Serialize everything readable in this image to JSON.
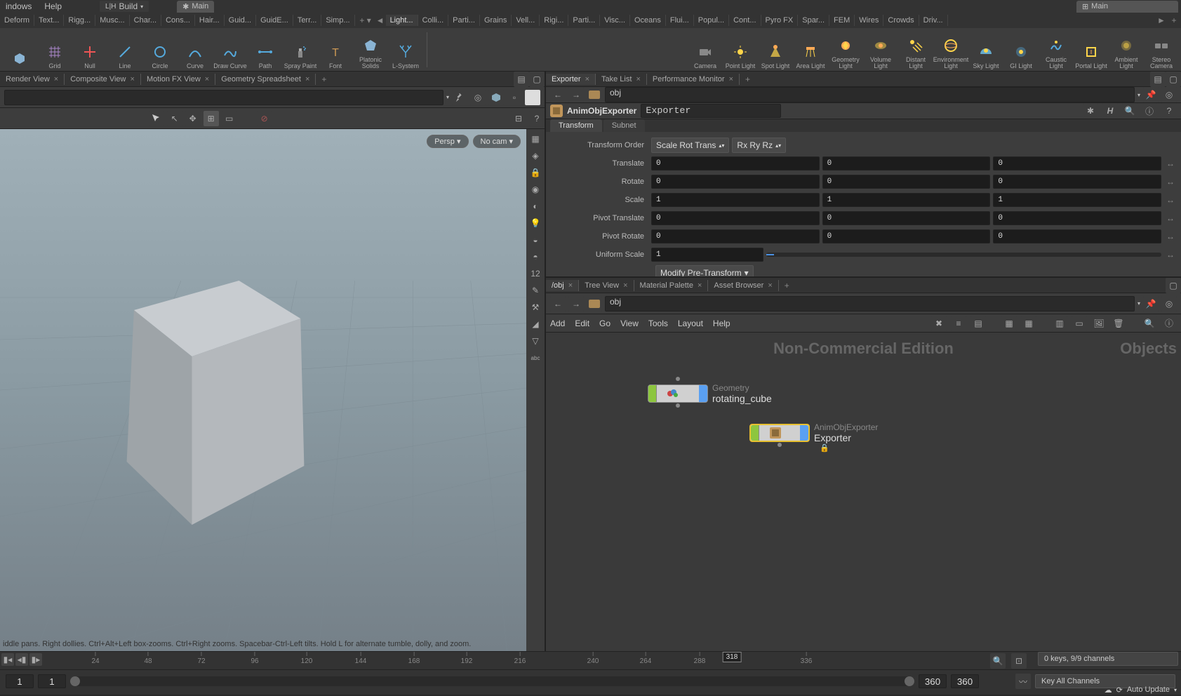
{
  "menu": {
    "windows": "indows",
    "help": "Help"
  },
  "build_label": "Build",
  "desktop_main": "Main",
  "shelf_tabs_left": [
    "Deform",
    "Text...",
    "Rigg...",
    "Musc...",
    "Char...",
    "Cons...",
    "Hair...",
    "Guid...",
    "GuidE...",
    "Terr...",
    "Simp..."
  ],
  "shelf_tabs_right": [
    "Light...",
    "Colli...",
    "Parti...",
    "Grains",
    "Vell...",
    "Rigi...",
    "Parti...",
    "Visc...",
    "Oceans",
    "Flui...",
    "Popul...",
    "Cont...",
    "Pyro FX",
    "Spar...",
    "FEM",
    "Wires",
    "Crowds",
    "Driv..."
  ],
  "shelf_left": [
    {
      "label": "",
      "icon": "box"
    },
    {
      "label": "Grid",
      "icon": "grid"
    },
    {
      "label": "Null",
      "icon": "null"
    },
    {
      "label": "Line",
      "icon": "line"
    },
    {
      "label": "Circle",
      "icon": "circle"
    },
    {
      "label": "Curve",
      "icon": "curve"
    },
    {
      "label": "Draw Curve",
      "icon": "draw"
    },
    {
      "label": "Path",
      "icon": "path"
    },
    {
      "label": "Spray Paint",
      "icon": "spray"
    },
    {
      "label": "Font",
      "icon": "font"
    },
    {
      "label": "Platonic Solids",
      "icon": "platonic"
    },
    {
      "label": "L-System",
      "icon": "lsys"
    }
  ],
  "shelf_right": [
    {
      "label": "Camera",
      "icon": "camera"
    },
    {
      "label": "Point Light",
      "icon": "point"
    },
    {
      "label": "Spot Light",
      "icon": "spot"
    },
    {
      "label": "Area Light",
      "icon": "area"
    },
    {
      "label": "Geometry Light",
      "icon": "geolight"
    },
    {
      "label": "Volume Light",
      "icon": "volume"
    },
    {
      "label": "Distant Light",
      "icon": "distant"
    },
    {
      "label": "Environment Light",
      "icon": "env"
    },
    {
      "label": "Sky Light",
      "icon": "sky"
    },
    {
      "label": "GI Light",
      "icon": "gi"
    },
    {
      "label": "Caustic Light",
      "icon": "caustic"
    },
    {
      "label": "Portal Light",
      "icon": "portal"
    },
    {
      "label": "Ambient Light",
      "icon": "ambient"
    },
    {
      "label": "Stereo Camera",
      "icon": "stereo"
    }
  ],
  "left_tabs": [
    "Render View",
    "Composite View",
    "Motion FX View",
    "Geometry Spreadsheet"
  ],
  "right_top_tabs": [
    "Exporter",
    "Take List",
    "Performance Monitor"
  ],
  "right_bot_tabs": [
    "/obj",
    "Tree View",
    "Material Palette",
    "Asset Browser"
  ],
  "path": {
    "obj": "obj"
  },
  "viewport": {
    "persp": "Persp",
    "nocam": "No cam",
    "hint": "iddle pans. Right dollies. Ctrl+Alt+Left box-zooms. Ctrl+Right zooms. Spacebar-Ctrl-Left tilts. Hold L for alternate tumble, dolly, and zoom."
  },
  "parm": {
    "type": "AnimObjExporter",
    "name": "Exporter",
    "tabs": [
      "Transform",
      "Subnet"
    ],
    "xform_order_label": "Transform Order",
    "xform_order": "Scale Rot Trans",
    "rot_order": "Rx Ry Rz",
    "rows": [
      {
        "label": "Translate",
        "x": "0",
        "y": "0",
        "z": "0"
      },
      {
        "label": "Rotate",
        "x": "0",
        "y": "0",
        "z": "0"
      },
      {
        "label": "Scale",
        "x": "1",
        "y": "1",
        "z": "1"
      },
      {
        "label": "Pivot Translate",
        "x": "0",
        "y": "0",
        "z": "0"
      },
      {
        "label": "Pivot Rotate",
        "x": "0",
        "y": "0",
        "z": "0"
      }
    ],
    "uniform_scale_label": "Uniform Scale",
    "uniform_scale": "1",
    "modify_pre": "Modify Pre-Transform"
  },
  "network": {
    "menu": [
      "Add",
      "Edit",
      "Go",
      "View",
      "Tools",
      "Layout",
      "Help"
    ],
    "watermark": "Non-Commercial Edition",
    "objects": "Objects",
    "node1": {
      "type": "Geometry",
      "name": "rotating_cube"
    },
    "node2": {
      "type": "AnimObjExporter",
      "name": "Exporter"
    }
  },
  "timeline": {
    "ticks": [
      60,
      84,
      108,
      132,
      156,
      180,
      204,
      228,
      252,
      276,
      300,
      324,
      348
    ],
    "tick_labels": [
      "",
      "24",
      "48",
      "72",
      "96",
      "120",
      "144",
      "168",
      "192",
      "216",
      "",
      "240",
      "264",
      "288",
      "",
      "336",
      ""
    ],
    "frame": "318",
    "start1": "1",
    "start2": "1",
    "end1": "360",
    "end2": "360",
    "keys": "0 keys, 9/9 channels",
    "key_all": "Key All Channels",
    "auto_update": "Auto Update"
  }
}
